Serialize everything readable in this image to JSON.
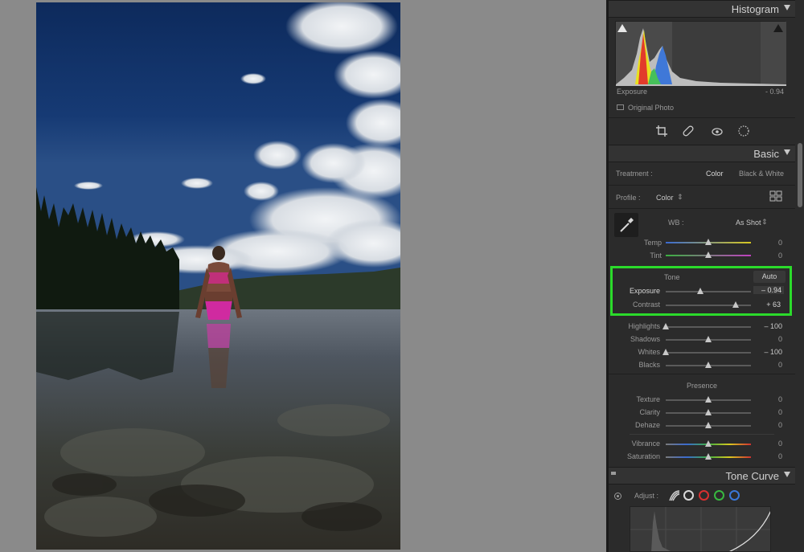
{
  "histogram": {
    "title": "Histogram",
    "readout_label": "Exposure",
    "readout_value": "- 0.94",
    "original_photo_label": "Original Photo"
  },
  "tools": [
    "crop-icon",
    "heal-icon",
    "redeye-icon",
    "mask-icon"
  ],
  "basic": {
    "title": "Basic",
    "treatment_label": "Treatment :",
    "treatment_color": "Color",
    "treatment_bw": "Black & White",
    "profile_label": "Profile :",
    "profile_value": "Color",
    "wb_label": "WB :",
    "wb_value": "As Shot",
    "temp": {
      "label": "Temp",
      "value": "0",
      "level": 0.5
    },
    "tint": {
      "label": "Tint",
      "value": "0",
      "level": 0.5
    },
    "tone_label": "Tone",
    "auto_label": "Auto",
    "exposure": {
      "label": "Exposure",
      "value": "– 0.94",
      "level": 0.41
    },
    "contrast": {
      "label": "Contrast",
      "value": "+ 63",
      "level": 0.82
    },
    "highlights": {
      "label": "Highlights",
      "value": "– 100",
      "level": 0.0
    },
    "shadows": {
      "label": "Shadows",
      "value": "0",
      "level": 0.5
    },
    "whites": {
      "label": "Whites",
      "value": "– 100",
      "level": 0.0
    },
    "blacks": {
      "label": "Blacks",
      "value": "0",
      "level": 0.5
    },
    "presence_label": "Presence",
    "texture": {
      "label": "Texture",
      "value": "0",
      "level": 0.5
    },
    "clarity": {
      "label": "Clarity",
      "value": "0",
      "level": 0.5
    },
    "dehaze": {
      "label": "Dehaze",
      "value": "0",
      "level": 0.5
    },
    "vibrance": {
      "label": "Vibrance",
      "value": "0",
      "level": 0.5
    },
    "saturation": {
      "label": "Saturation",
      "value": "0",
      "level": 0.5
    }
  },
  "tone_curve": {
    "title": "Tone Curve",
    "adjust_label": "Adjust :"
  },
  "colors": {
    "highlight_box": "#2bdb2b",
    "panel_bg": "#2b2b2b"
  }
}
